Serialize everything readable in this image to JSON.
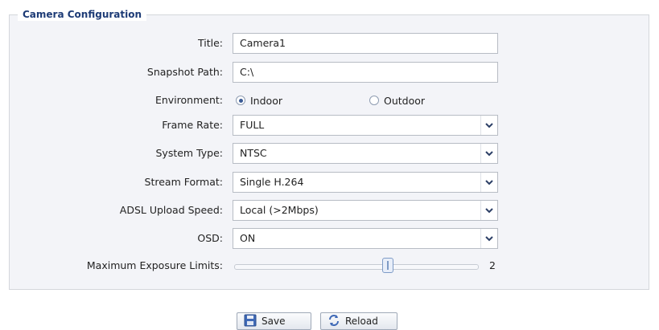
{
  "legend": "Camera Configuration",
  "fields": {
    "title": {
      "label": "Title:",
      "value": "Camera1"
    },
    "snapshot_path": {
      "label": "Snapshot Path:",
      "value": "C:\\"
    },
    "environment": {
      "label": "Environment:",
      "options": [
        "Indoor",
        "Outdoor"
      ],
      "selected": "Indoor"
    },
    "frame_rate": {
      "label": "Frame Rate:",
      "value": "FULL"
    },
    "system_type": {
      "label": "System Type:",
      "value": "NTSC"
    },
    "stream_format": {
      "label": "Stream Format:",
      "value": "Single H.264"
    },
    "adsl_upload_speed": {
      "label": "ADSL Upload Speed:",
      "value": "Local (>2Mbps)"
    },
    "osd": {
      "label": "OSD:",
      "value": "ON"
    },
    "max_exposure": {
      "label": "Maximum Exposure Limits:",
      "value": "2",
      "level_fraction": 0.64
    }
  },
  "buttons": {
    "save": "Save",
    "reload": "Reload"
  },
  "icons": {
    "dropdown": "chevron-down-icon",
    "save": "floppy-disk-icon",
    "reload": "refresh-icon"
  },
  "colors": {
    "legend": "#1d3b76",
    "panel_bg": "#f3f4f8",
    "border": "#b7bcc4"
  }
}
